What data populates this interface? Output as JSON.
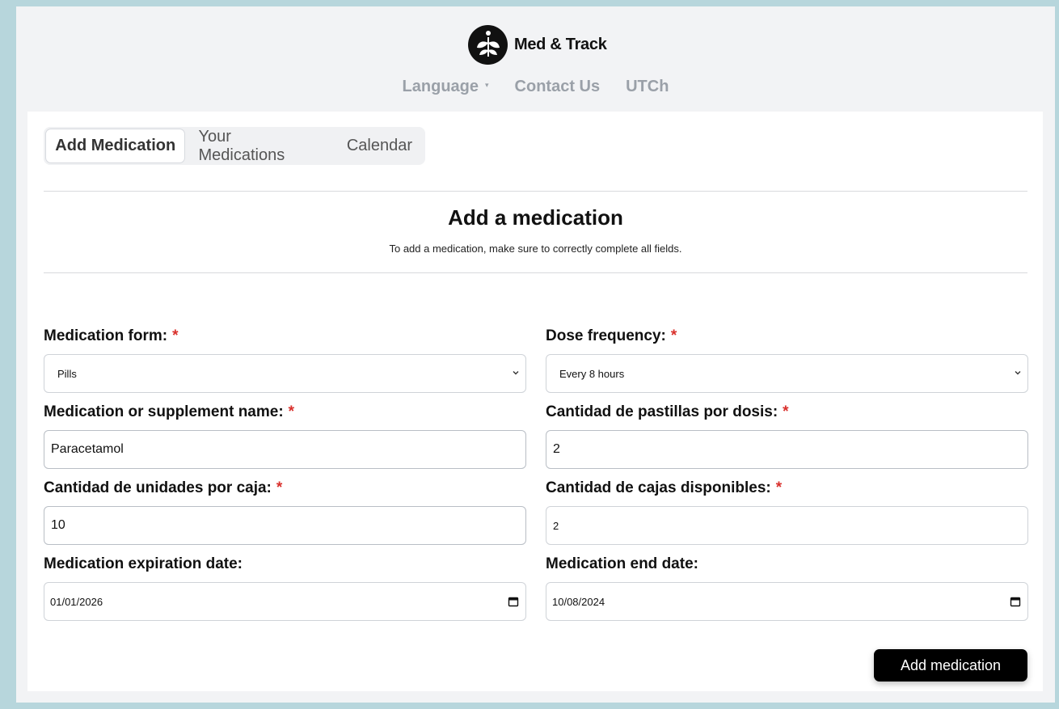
{
  "brand": {
    "name": "Med & Track",
    "logo_icon": "leaf-logo-icon"
  },
  "nav": {
    "language": "Language",
    "contact": "Contact Us",
    "utch": "UTCh"
  },
  "tabs": [
    "Add Medication",
    "Your Medications",
    "Calendar"
  ],
  "form": {
    "title": "Add a medication",
    "subtitle": "To add a medication, make sure to correctly complete all fields.",
    "required_mark": "*",
    "medication_form": {
      "label": "Medication form:",
      "value": "Pills"
    },
    "dose_frequency": {
      "label": "Dose frequency:",
      "value": "Every 8 hours"
    },
    "name": {
      "label": "Medication or supplement name:",
      "value": "Paracetamol"
    },
    "pills_per_dose": {
      "label": "Cantidad de pastillas por dosis:",
      "value": "2"
    },
    "units_per_box": {
      "label": "Cantidad de unidades por caja:",
      "value": "10"
    },
    "boxes_available": {
      "label": "Cantidad de cajas disponibles:",
      "value": "2"
    },
    "expiration_date": {
      "label": "Medication expiration date:",
      "value": "01/01/2026"
    },
    "end_date": {
      "label": "Medication end date:",
      "value": "10/08/2024"
    },
    "submit_label": "Add medication"
  },
  "colors": {
    "accent": "#000000",
    "required": "#d9302c",
    "page_bg": "#b7d6dc",
    "nav_text": "#9aa0a8"
  }
}
